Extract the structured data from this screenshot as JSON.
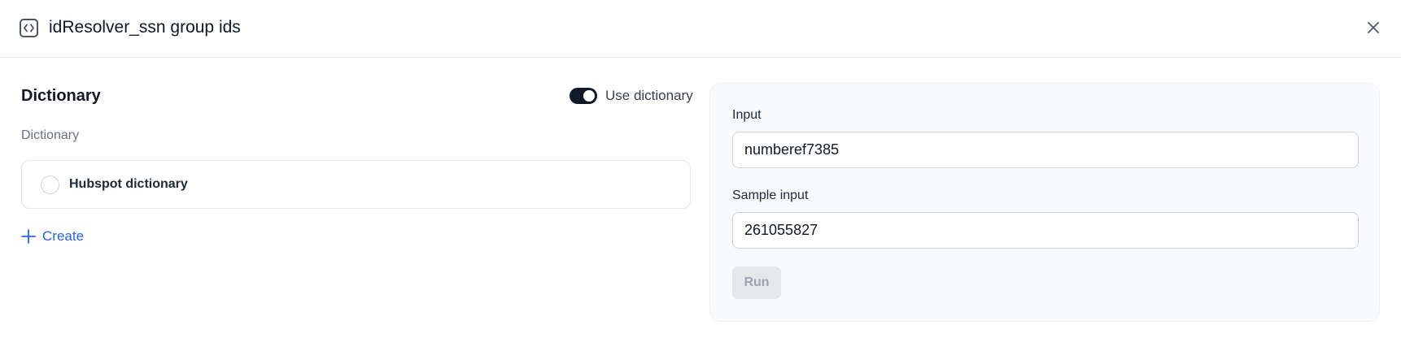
{
  "header": {
    "title": "idResolver_ssn group ids",
    "icon": "code-brackets-icon",
    "close_icon": "close-icon"
  },
  "dictionary_section": {
    "title": "Dictionary",
    "toggle": {
      "label": "Use dictionary",
      "on": true
    },
    "field_label": "Dictionary",
    "options": [
      {
        "label": "Hubspot dictionary",
        "selected": false
      }
    ],
    "create_label": "Create"
  },
  "test_panel": {
    "input_label": "Input",
    "input_value": "numberef7385",
    "sample_label": "Sample input",
    "sample_value": "261055827",
    "run_label": "Run",
    "run_disabled": true
  },
  "colors": {
    "accent": "#2563eb",
    "toggle_on": "#111827",
    "panel_bg": "#f9fafb"
  }
}
